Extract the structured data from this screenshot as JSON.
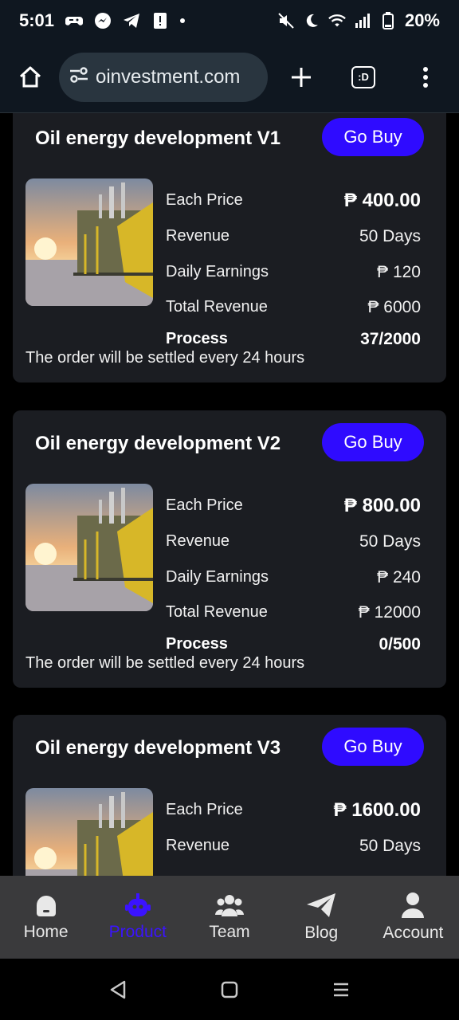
{
  "status": {
    "time": "5:01",
    "battery": "20%"
  },
  "browser": {
    "url": "oinvestment.com",
    "tab_label": ":D"
  },
  "labels": {
    "each_price": "Each Price",
    "revenue": "Revenue",
    "daily_earnings": "Daily Earnings",
    "total_revenue": "Total Revenue",
    "process": "Process",
    "note": "The order will be settled every 24 hours",
    "buy": "Go Buy"
  },
  "products": [
    {
      "title": "Oil energy development V1",
      "price": "₱ 400.00",
      "revenue": "50 Days",
      "daily": "₱ 120",
      "total": "₱ 6000",
      "process": "37/2000"
    },
    {
      "title": "Oil energy development V2",
      "price": "₱ 800.00",
      "revenue": "50 Days",
      "daily": "₱ 240",
      "total": "₱ 12000",
      "process": "0/500"
    },
    {
      "title": "Oil energy development V3",
      "price": "₱ 1600.00",
      "revenue": "50 Days"
    }
  ],
  "nav": [
    {
      "label": "Home",
      "icon": "home-icon"
    },
    {
      "label": "Product",
      "icon": "robot-icon",
      "active": true
    },
    {
      "label": "Team",
      "icon": "team-icon"
    },
    {
      "label": "Blog",
      "icon": "send-icon"
    },
    {
      "label": "Account",
      "icon": "user-icon"
    }
  ],
  "colors": {
    "accent": "#2f0bff",
    "active_nav": "#3b13ff",
    "card_bg": "#1b1d22",
    "nav_bg": "#3a3a3c"
  }
}
